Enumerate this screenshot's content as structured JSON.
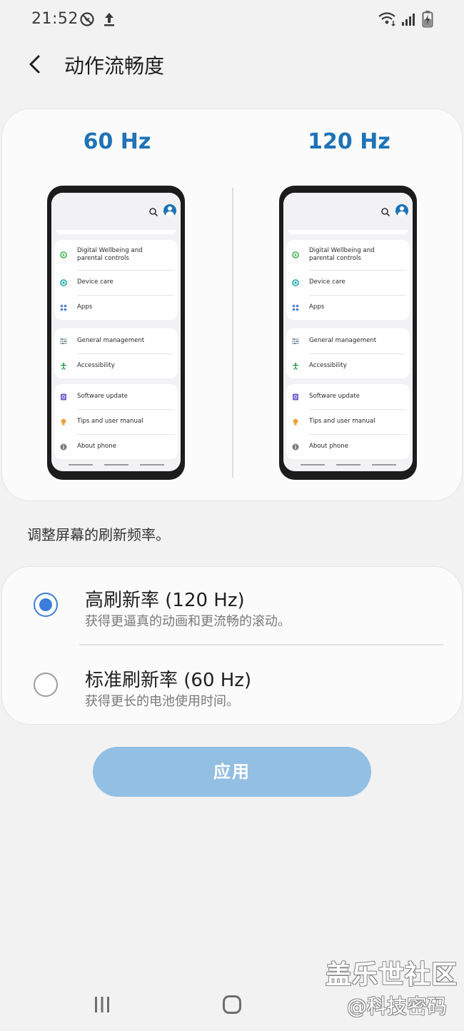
{
  "status_bar": {
    "time": "21:52",
    "icons": [
      "do-not-disturb-icon",
      "upload-icon",
      "wifi-icon",
      "signal-icon",
      "battery-icon"
    ]
  },
  "header": {
    "title": "动作流畅度",
    "back_icon": "chevron-left-icon"
  },
  "preview": {
    "left_label": "60 Hz",
    "right_label": "120 Hz",
    "phone_items": {
      "group1": [
        "Digital Wellbeing and parental controls",
        "Device care",
        "Apps"
      ],
      "group2": [
        "General management",
        "Accessibility"
      ],
      "group3": [
        "Software update",
        "Tips and user manual",
        "About phone"
      ]
    }
  },
  "description": "调整屏幕的刷新频率。",
  "options": [
    {
      "title": "高刷新率 (120 Hz)",
      "subtitle": "获得更逼真的动画和更流畅的滚动。",
      "selected": true
    },
    {
      "title": "标准刷新率 (60 Hz)",
      "subtitle": "获得更长的电池使用时间。",
      "selected": false
    }
  ],
  "apply_button": "应用",
  "watermark": {
    "line1": "盖乐世社区",
    "line2": "@科技密码"
  },
  "colors": {
    "accent": "#1f73b7",
    "radio": "#3b7dd8",
    "apply_bg": "#93bfe3",
    "background": "#f2f2f2"
  }
}
